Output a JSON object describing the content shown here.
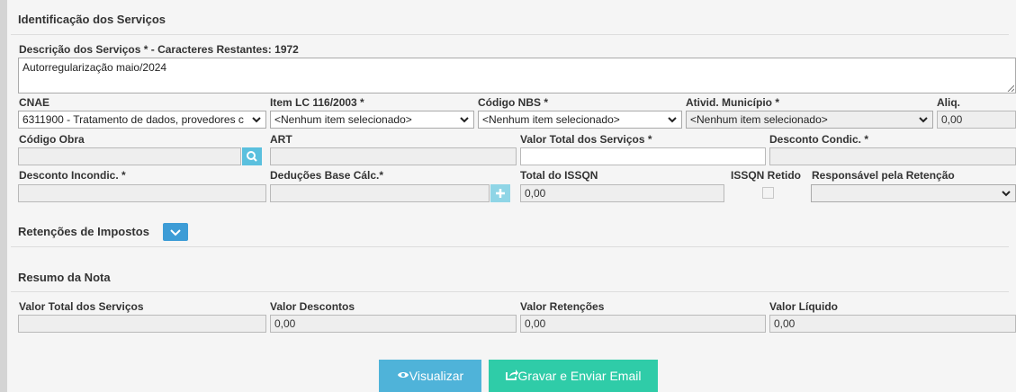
{
  "section_title": "Identificação dos Serviços",
  "descricao": {
    "label": "Descrição dos Serviços * - Caracteres Restantes: 1972",
    "value": "Autorregularização maio/2024"
  },
  "row1": {
    "cnae_label": "CNAE",
    "cnae_value": "6311900 - Tratamento de dados, provedores c",
    "itemlc_label": "Item LC 116/2003 *",
    "itemlc_value": "<Nenhum item selecionado>",
    "nbs_label": "Código NBS *",
    "nbs_value": "<Nenhum item selecionado>",
    "ativid_label": "Ativid. Município *",
    "ativid_value": "<Nenhum item selecionado>",
    "aliq_label": "Aliq.",
    "aliq_value": "0,00"
  },
  "row2": {
    "obra_label": "Código Obra",
    "obra_value": "",
    "art_label": "ART",
    "art_value": "",
    "valor_total_label": "Valor Total dos Serviços *",
    "valor_total_value": "",
    "desc_cond_label": "Desconto Condic. *",
    "desc_cond_value": ""
  },
  "row3": {
    "desc_incond_label": "Desconto Incondic. *",
    "desc_incond_value": "",
    "deducoes_label": "Deduções Base Cálc.*",
    "deducoes_value": "",
    "total_issqn_label": "Total do ISSQN",
    "total_issqn_value": "0,00",
    "issqn_retido_label": "ISSQN Retido",
    "issqn_retido_checked": false,
    "responsavel_label": "Responsável pela Retenção",
    "responsavel_value": ""
  },
  "retencoes_title": "Retenções de Impostos",
  "resumo": {
    "title": "Resumo da Nota",
    "valor_total_label": "Valor Total dos Serviços",
    "valor_total_value": "",
    "valor_descontos_label": "Valor Descontos",
    "valor_descontos_value": "0,00",
    "valor_retencoes_label": "Valor Retenções",
    "valor_retencoes_value": "0,00",
    "valor_liquido_label": "Valor Líquido",
    "valor_liquido_value": "0,00"
  },
  "buttons": {
    "visualizar": "Visualizar",
    "gravar": "Gravar e Enviar Email"
  },
  "icons": {
    "search": "search-icon",
    "plus": "plus-icon",
    "chevron": "chevron-down-icon",
    "eye": "eye-icon",
    "share": "share-icon"
  },
  "colors": {
    "info": "#5bc0de",
    "primary": "#3d9cd6",
    "success": "#2fcca8"
  }
}
